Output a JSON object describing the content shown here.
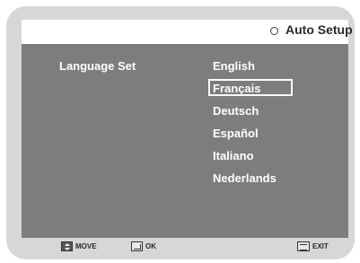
{
  "header": {
    "title": "Auto Setup",
    "icon": "circle-icon"
  },
  "menu": {
    "label": "Language Set",
    "options": [
      "English",
      "Français",
      "Deutsch",
      "Español",
      "Italiano",
      "Nederlands"
    ],
    "selected_index": 1,
    "selected_value": "Français"
  },
  "footer": {
    "move_label": "MOVE",
    "ok_label": "OK",
    "exit_label": "EXIT"
  },
  "colors": {
    "frame": "#d7d7d7",
    "panel": "#7d7d7d",
    "title_bar": "#ffffff",
    "text_on_panel": "#ffffff"
  }
}
